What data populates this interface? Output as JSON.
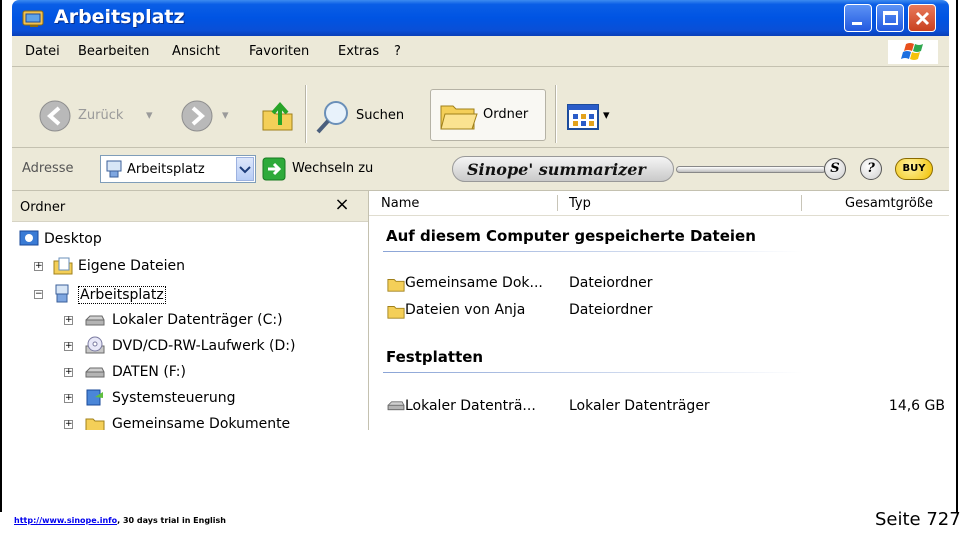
{
  "window": {
    "title": "Arbeitsplatz"
  },
  "menubar": {
    "items": [
      "Datei",
      "Bearbeiten",
      "Ansicht",
      "Favoriten",
      "Extras",
      "?"
    ]
  },
  "toolbar": {
    "back_label": "Zurück",
    "search_label": "Suchen",
    "folders_label": "Ordner"
  },
  "addressbar": {
    "label": "Adresse",
    "value": "Arbeitsplatz",
    "go_label": "Wechseln zu",
    "plugin_name": "Sinope",
    "plugin_suffix": "summarizer",
    "buy_label": "BUY",
    "s_label": "S",
    "help_label": "?"
  },
  "folders_pane": {
    "title": "Ordner",
    "close": "×",
    "items": [
      {
        "label": "Desktop",
        "icon": "desktop-icon"
      },
      {
        "label": "Eigene Dateien",
        "icon": "my-documents-icon"
      },
      {
        "label": "Arbeitsplatz",
        "icon": "my-computer-icon"
      },
      {
        "label": "Lokaler Datenträger (C:)",
        "icon": "hard-drive-icon"
      },
      {
        "label": "DVD/CD-RW-Laufwerk (D:)",
        "icon": "cd-drive-icon"
      },
      {
        "label": "DATEN (F:)",
        "icon": "hard-drive-icon"
      },
      {
        "label": "Systemsteuerung",
        "icon": "control-panel-icon"
      },
      {
        "label": "Gemeinsame Dokumente",
        "icon": "folder-icon"
      }
    ]
  },
  "details": {
    "columns": [
      "Name",
      "Typ",
      "Gesamtgröße"
    ],
    "groups": [
      {
        "title": "Auf diesem Computer gespeicherte Dateien",
        "rows": [
          {
            "name": "Gemeinsame Dok...",
            "type": "Dateiordner",
            "size": ""
          },
          {
            "name": "Dateien von Anja",
            "type": "Dateiordner",
            "size": ""
          }
        ]
      },
      {
        "title": "Festplatten",
        "rows": [
          {
            "name": "Lokaler Datenträ...",
            "type": "Lokaler Datenträger",
            "size": "14,6 GB"
          }
        ]
      }
    ]
  },
  "footer": {
    "link": "http://www.sinope.info",
    "trial": ", 30 days trial in English",
    "page": "Seite 727"
  }
}
